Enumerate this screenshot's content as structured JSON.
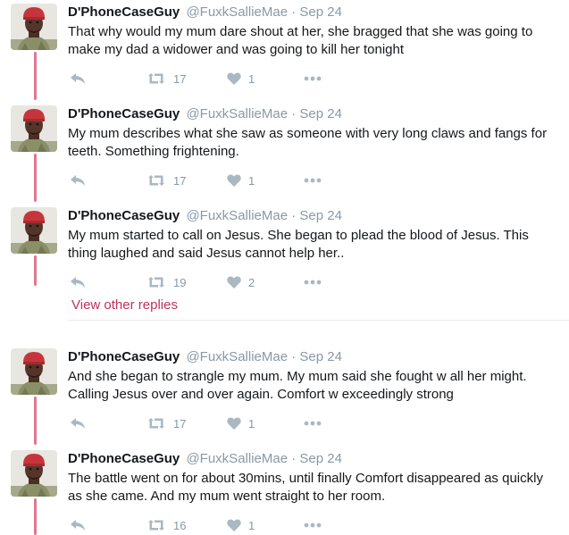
{
  "view_other_replies": "View other replies",
  "tweets": [
    {
      "name": "D'PhoneCaseGuy",
      "handle": "@FuxkSallieMae",
      "separator": "·",
      "date": "Sep 24",
      "text": "That why would my mum dare shout at her,  she bragged that she was going to make my dad a widower and was going to kill her tonight",
      "retweets": "17",
      "likes": "1"
    },
    {
      "name": "D'PhoneCaseGuy",
      "handle": "@FuxkSallieMae",
      "separator": "·",
      "date": "Sep 24",
      "text": "My mum describes what she saw as someone with very long claws and fangs for teeth.  Something frightening.",
      "retweets": "17",
      "likes": "1"
    },
    {
      "name": "D'PhoneCaseGuy",
      "handle": "@FuxkSallieMae",
      "separator": "·",
      "date": "Sep 24",
      "text": "My mum started to call on Jesus.  She began to plead the blood of Jesus.  This thing laughed and said Jesus cannot help her..",
      "retweets": "19",
      "likes": "2"
    },
    {
      "name": "D'PhoneCaseGuy",
      "handle": "@FuxkSallieMae",
      "separator": "·",
      "date": "Sep 24",
      "text": "And she began to strangle my mum.  My mum said she fought w all her might. Calling Jesus over and over again. Comfort w exceedingly strong",
      "retweets": "17",
      "likes": "1"
    },
    {
      "name": "D'PhoneCaseGuy",
      "handle": "@FuxkSallieMae",
      "separator": "·",
      "date": "Sep 24",
      "text": "The battle went on for about 30mins,  until finally Comfort disappeared as quickly as she came. And my mum went straight to her room.",
      "retweets": "16",
      "likes": "1"
    }
  ]
}
